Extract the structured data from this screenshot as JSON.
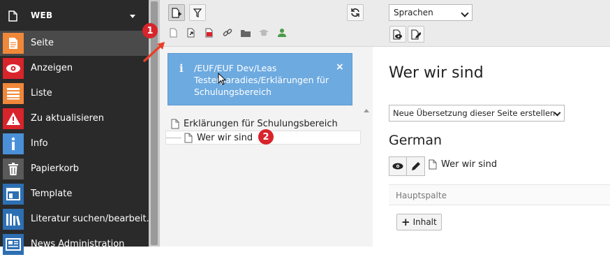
{
  "sidebar": {
    "group_label": "WEB",
    "items": [
      {
        "label": "Seite",
        "icon": "page-icon",
        "color": "#f0883a"
      },
      {
        "label": "Anzeigen",
        "icon": "eye-icon",
        "color": "#d8242b"
      },
      {
        "label": "Liste",
        "icon": "list-icon",
        "color": "#f0883a"
      },
      {
        "label": "Zu aktualisieren",
        "icon": "warning-icon",
        "color": "#d8242b"
      },
      {
        "label": "Info",
        "icon": "info-icon",
        "color": "#4a90d9"
      },
      {
        "label": "Papierkorb",
        "icon": "trash-icon",
        "color": "#5a5a5a"
      },
      {
        "label": "Template",
        "icon": "template-icon",
        "color": "#2d6fb3"
      },
      {
        "label": "Literatur suchen/bearbeit...",
        "icon": "books-icon",
        "color": "#2d6fb3"
      },
      {
        "label": "News Administration",
        "icon": "news-icon",
        "color": "#2d6fb3"
      }
    ]
  },
  "tree": {
    "info": {
      "icon_glyph": "i",
      "text": "/EUF/EUF Dev/Leas Testerparadies/Erklärungen für Schulungsbereich",
      "close_glyph": "×"
    },
    "nodes": [
      {
        "label": "Erklärungen für Schulungsbereich"
      },
      {
        "label": "Wer wir sind"
      }
    ]
  },
  "annotations": {
    "marker_1": "1",
    "marker_2": "2",
    "color": "#d8242b"
  },
  "content": {
    "language_select": "Sprachen",
    "page_title": "Wer wir sind",
    "translation_select": "Neue Übersetzung dieser Seite erstellen",
    "language_heading": "German",
    "page_ref_label": "Wer wir sind",
    "column_label": "Hauptspalte",
    "add_content_label": "Inhalt"
  }
}
